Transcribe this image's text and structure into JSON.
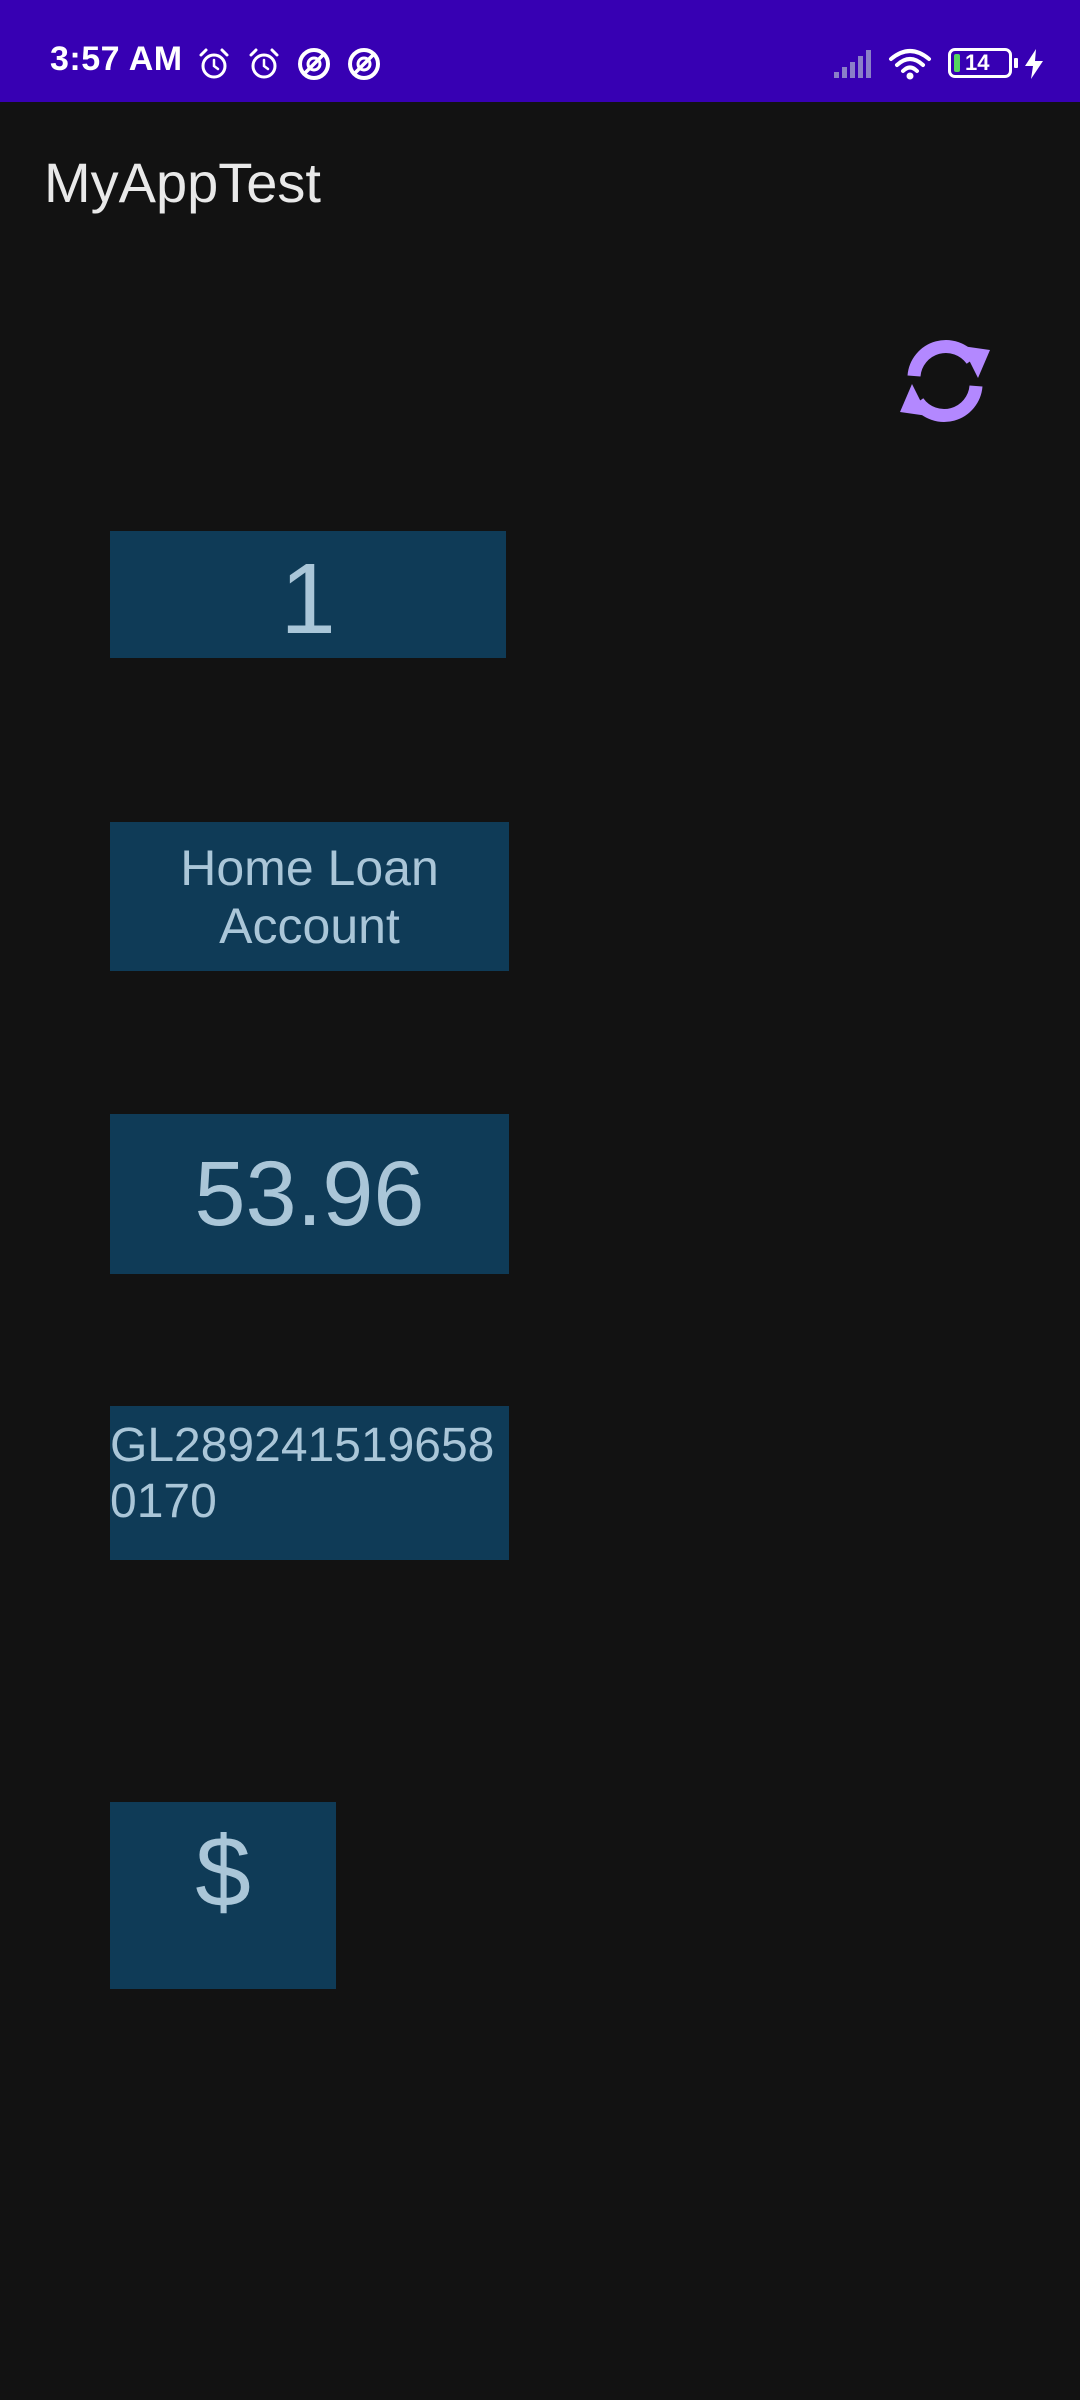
{
  "status_bar": {
    "time": "3:57 AM",
    "battery_level": "14",
    "icons": [
      "alarm-icon",
      "alarm-icon",
      "no-disturb-icon",
      "no-disturb-icon",
      "signal-icon",
      "wifi-icon",
      "battery-icon",
      "charging-icon"
    ]
  },
  "app_bar": {
    "title": "MyAppTest"
  },
  "refresh": {
    "icon": "refresh-icon",
    "color": "#b388ff"
  },
  "account": {
    "number": "1",
    "type": "Home Loan Account",
    "balance": "53.96",
    "account_id": "GL2892415196580170",
    "currency": "$"
  },
  "colors": {
    "status_bar": "#3700b3",
    "background": "#121212",
    "box_background": "#0f3b57",
    "box_text": "#aac6d8"
  }
}
